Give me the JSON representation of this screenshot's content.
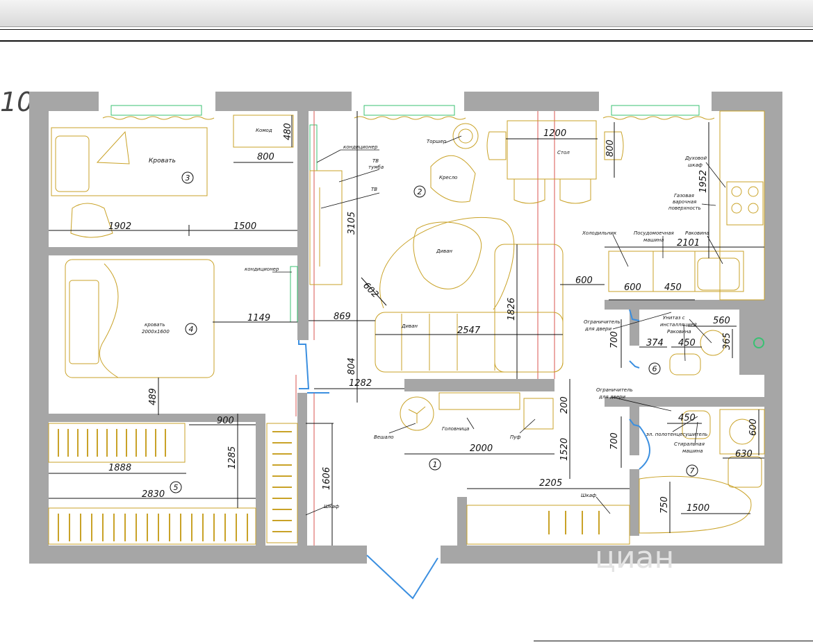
{
  "sheet_number": "10",
  "rooms": {
    "r1": "1",
    "r2": "2",
    "r3": "3",
    "r4": "4",
    "r5": "5",
    "r6": "6",
    "r7": "7"
  },
  "furniture": {
    "komod": "Комод",
    "krovat": "Кровать",
    "krovat_2000": "кровать",
    "krovat_2000_size": "2000х1600",
    "kondicioner_1": "кондиционер",
    "kondicioner_2": "кондиционер",
    "tv_tumba_1": "ТВ",
    "tv_tumba_2": "тумба",
    "tv": "ТВ",
    "torsher": "Торшер",
    "kreslo": "Кресло",
    "stol": "Стол",
    "divan_round": "Диван",
    "divan": "Диван",
    "duhovoy_1": "Духовой",
    "duhovoy_2": "шкаф",
    "gas_1": "Газовая",
    "gas_2": "варочная",
    "gas_3": "поверхность",
    "holodilnik": "Холодильник",
    "posudo_1": "Посудомоечная",
    "posudo_2": "машина",
    "rakovina_kitchen": "Раковина",
    "ogr_1a": "Ограничитель",
    "ogr_1b": "для двери",
    "unitaz_1": "Унитаз с",
    "unitaz_2": "инсталляцией",
    "rakovina_bath": "Раковина",
    "veshalo": "Вешало",
    "golovnica": "Головница",
    "pufe": "Пуф",
    "ogr_2a": "Ограничитель",
    "ogr_2b": "для двери",
    "polotence": "эл. полотенцесушитель",
    "stir_1": "Стиральная",
    "stir_2": "машина",
    "shkaf_1": "Шкаф",
    "shkaf_2": "Шкаф"
  },
  "dimensions": {
    "d480": "480",
    "d800a": "800",
    "d1902": "1902",
    "d1500a": "1500",
    "d3105": "3105",
    "d1200": "1200",
    "d800b": "800",
    "d602": "602",
    "d1826": "1826",
    "d2547": "2547",
    "d869": "869",
    "d1149": "1149",
    "d600a": "600",
    "d1952": "1952",
    "d2101": "2101",
    "d600b": "600",
    "d450a": "450",
    "d560": "560",
    "d374": "374",
    "d450b": "450",
    "d365": "365",
    "d700a": "700",
    "d804": "804",
    "d1282": "1282",
    "d489": "489",
    "d900": "900",
    "d1285": "1285",
    "d1888": "1888",
    "d2830": "2830",
    "d1606": "1606",
    "d2000": "2000",
    "d200": "200",
    "d1520": "1520",
    "d700b": "700",
    "d450c": "450",
    "d600c": "600",
    "d630": "630",
    "d2205": "2205",
    "d750": "750",
    "d1500b": "1500"
  },
  "watermark": "циан",
  "colors": {
    "wall": "#a6a6a6",
    "furniture": "#c9a227",
    "window": "#38c172",
    "door": "#3b8fe0",
    "red_line": "#d9534f"
  }
}
